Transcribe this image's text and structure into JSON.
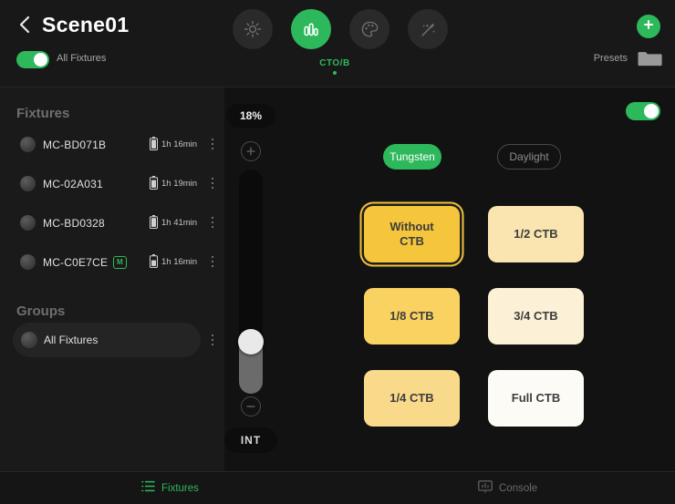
{
  "header": {
    "back_icon": "chevron-left-icon",
    "title": "Scene01",
    "mode_buttons": [
      {
        "icon": "brightness-sun-icon",
        "label": "Brightness",
        "active": false
      },
      {
        "icon": "bar-chart-icon",
        "label": "CTO/B",
        "active": true
      },
      {
        "icon": "palette-icon",
        "label": "Color",
        "active": false
      },
      {
        "icon": "magic-wand-icon",
        "label": "Effects",
        "active": false
      }
    ],
    "active_mode_label": "CTO/B",
    "all_fixtures_label": "All Fixtures",
    "all_fixtures_on": true,
    "add_icon": "plus-icon",
    "presets_label": "Presets",
    "presets_icon": "folder-icon"
  },
  "sidebar": {
    "fixtures_title": "Fixtures",
    "groups_title": "Groups",
    "fixtures": [
      {
        "name": "MC-BD071B",
        "badge": "",
        "battery": "1h 16min",
        "battery_icon": "battery-icon",
        "menu_icon": "kebab-menu-icon"
      },
      {
        "name": "MC-02A031",
        "badge": "",
        "battery": "1h 19min",
        "battery_icon": "battery-icon",
        "menu_icon": "kebab-menu-icon"
      },
      {
        "name": "MC-BD0328",
        "badge": "",
        "battery": "1h 41min",
        "battery_icon": "battery-icon",
        "menu_icon": "kebab-menu-icon"
      },
      {
        "name": "MC-C0E7CE",
        "badge": "M",
        "battery": "1h 16min",
        "battery_icon": "battery-icon",
        "menu_icon": "kebab-menu-icon"
      }
    ],
    "groups": [
      {
        "name": "All Fixtures",
        "menu_icon": "kebab-menu-icon"
      }
    ]
  },
  "slider": {
    "percent_label": "18%",
    "value": 18,
    "increase_icon": "plus-circle-icon",
    "decrease_icon": "minus-circle-icon",
    "mode_label": "INT"
  },
  "right_panel": {
    "enabled": true,
    "white_balance": [
      {
        "label": "Tungsten",
        "active": true
      },
      {
        "label": "Daylight",
        "active": false
      }
    ],
    "ctb_options": [
      {
        "label": "Without CTB",
        "color": "#F5C63C",
        "selected": true
      },
      {
        "label": "1/2 CTB",
        "color": "#FAE4B0",
        "selected": false
      },
      {
        "label": "1/8 CTB",
        "color": "#F9D262",
        "selected": false
      },
      {
        "label": "3/4 CTB",
        "color": "#FCF0D6",
        "selected": false
      },
      {
        "label": "1/4 CTB",
        "color": "#F9D98A",
        "selected": false
      },
      {
        "label": "Full CTB",
        "color": "#FDFBF6",
        "selected": false
      }
    ]
  },
  "bottom_nav": [
    {
      "label": "Fixtures",
      "icon": "list-icon",
      "active": true
    },
    {
      "label": "Console",
      "icon": "console-monitor-icon",
      "active": false
    }
  ],
  "colors": {
    "accent_green": "#2eb85c",
    "selected_ring": "#f0c13c",
    "background": "#121212"
  }
}
